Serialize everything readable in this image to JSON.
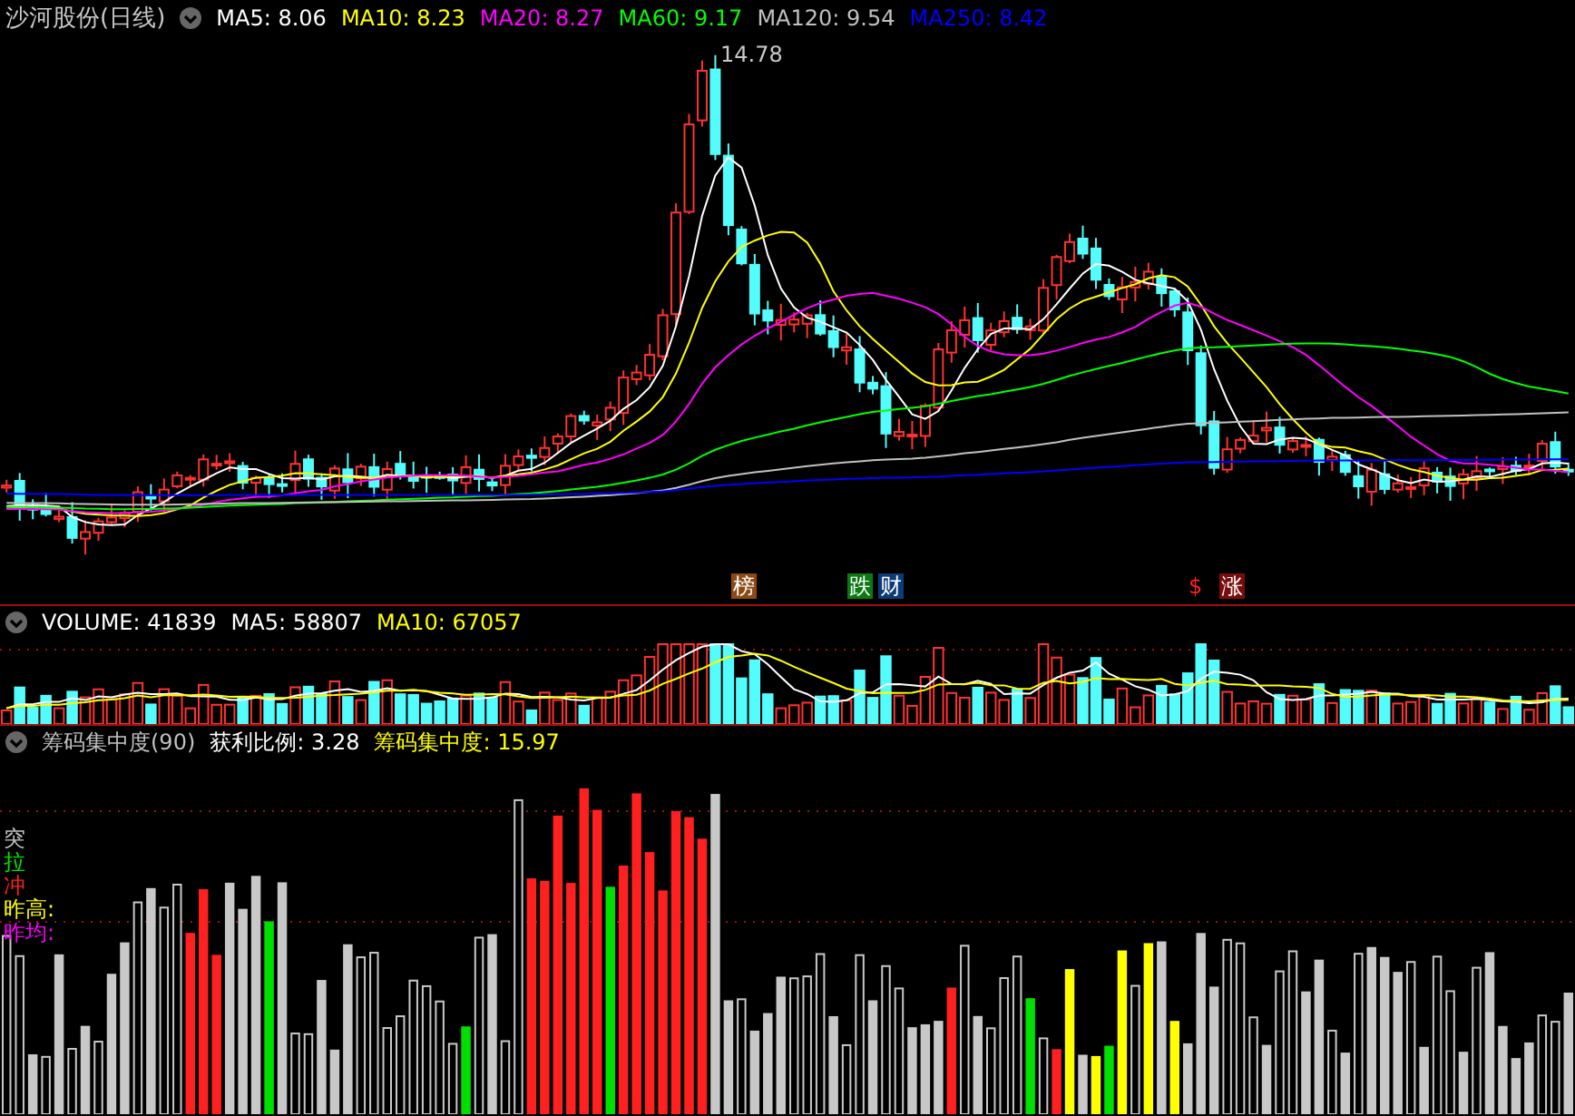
{
  "title": "沙河股份(日线)",
  "ma_legend": [
    {
      "label": "MA5: 8.06",
      "color": "#ffffff"
    },
    {
      "label": "MA10: 8.23",
      "color": "#ffff00"
    },
    {
      "label": "MA20: 8.27",
      "color": "#ff00ff"
    },
    {
      "label": "MA60: 9.17",
      "color": "#00ff00"
    },
    {
      "label": "MA120: 9.54",
      "color": "#c0c0c0"
    },
    {
      "label": "MA250: 8.42",
      "color": "#0000ff"
    }
  ],
  "peak_label": "14.78",
  "event_tags": [
    {
      "text": "榜",
      "kind": "tag",
      "color": "#8b4a14"
    },
    {
      "text": "跌",
      "kind": "tag",
      "color": "#0c7a14"
    },
    {
      "text": "财",
      "kind": "tag",
      "color": "#0c3c78"
    },
    {
      "text": "$",
      "kind": "symbol",
      "color": "#ff2020"
    },
    {
      "text": "涨",
      "kind": "tag",
      "color": "#7a0c0c"
    }
  ],
  "volume_legend": [
    {
      "label": "VOLUME: 41839",
      "color": "#ffffff"
    },
    {
      "label": "MA5: 58807",
      "color": "#ffffff"
    },
    {
      "label": "MA10: 67057",
      "color": "#ffff00"
    }
  ],
  "indicator_legend": [
    {
      "label": "筹码集中度(90)",
      "color": "#c0c0c0"
    },
    {
      "label": "获利比例: 3.28",
      "color": "#ffffff"
    },
    {
      "label": "筹码集中度: 15.97",
      "color": "#ffff00"
    }
  ],
  "side_labels": [
    {
      "text": "突",
      "color": "#c0c0c0"
    },
    {
      "text": "拉",
      "color": "#00e000"
    },
    {
      "text": "冲",
      "color": "#ff2020"
    },
    {
      "text": "昨高:",
      "color": "#ffff00"
    },
    {
      "text": "昨均:",
      "color": "#ff00ff"
    }
  ]
}
